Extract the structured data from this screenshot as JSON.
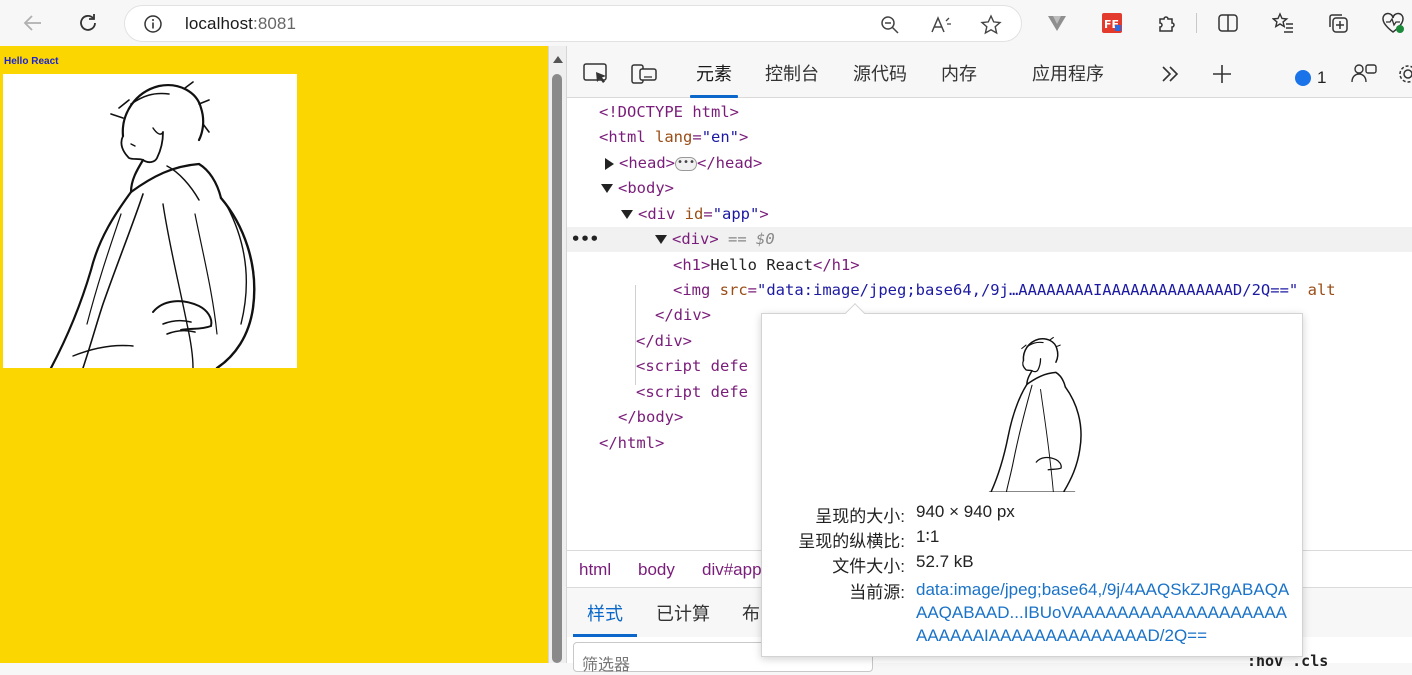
{
  "browser": {
    "url_host": "localhost",
    "url_port": ":8081"
  },
  "page": {
    "heading": "Hello React",
    "background": "#fbd600",
    "heading_color": "#1a24d6"
  },
  "devtools": {
    "tabs": [
      "元素",
      "控制台",
      "源代码",
      "内存",
      "应用程序"
    ],
    "active_tab": "元素",
    "issues_count": "1",
    "dom": {
      "doctype": "<!DOCTYPE html>",
      "html_open_tag": "<html",
      "html_lang_attr": "lang",
      "html_lang_val": "\"en\"",
      "head_open": "<head>",
      "head_close": "</head>",
      "body_open": "<body>",
      "div_app_tag": "<div",
      "div_app_attr": "id",
      "div_app_val": "\"app\"",
      "div_open": "<div>",
      "selected_marker": "== $0",
      "h1_open": "<h1>",
      "h1_text": "Hello React",
      "h1_close": "</h1>",
      "img_tag": "<img",
      "img_src_attr": "src",
      "img_src_val": "\"data:image/jpeg;base64,/9j…AAAAAAAAIAAAAAAAAAAAAAAD/2Q==\"",
      "img_alt_attr": "alt",
      "div_close": "</div>",
      "script_1": "<script defe",
      "script_2": "<script defe",
      "body_close": "</body>",
      "html_close": "</html>",
      "row_dots": "•••"
    },
    "breadcrumbs": [
      "html",
      "body",
      "div#app"
    ],
    "styles_tabs": [
      "样式",
      "已计算",
      "布"
    ],
    "filter_placeholder": "筛选器",
    "hov_cls": ":hov  .cls"
  },
  "tooltip": {
    "rendered_size_label": "呈现的大小:",
    "rendered_size_value": "940 × 940 px",
    "aspect_label": "呈现的纵横比:",
    "aspect_value": "1∶1",
    "file_size_label": "文件大小:",
    "file_size_value": "52.7 kB",
    "source_label": "当前源:",
    "source_value": "data:image/jpeg;base64,/9j/4AAQSkZJRgABAQAAAQABAAD...IBUoVAAAAAAAAAAAAAAAAAAAAAAAAAIAAAAAAAAAAAAAAD/2Q=="
  }
}
